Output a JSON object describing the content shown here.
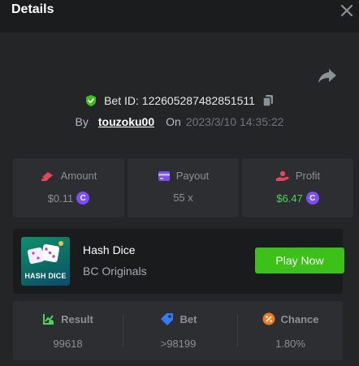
{
  "header": {
    "title": "Details"
  },
  "bet": {
    "id_text": "Bet ID: 122605287482851511",
    "by_label": "By",
    "username": "touzoku00",
    "on_label": "On",
    "datetime": "2023/3/10 14:35:22"
  },
  "stats": {
    "amount": {
      "label": "Amount",
      "value": "$0.11"
    },
    "payout": {
      "label": "Payout",
      "value": "55 x"
    },
    "profit": {
      "label": "Profit",
      "value": "$6.47"
    }
  },
  "game": {
    "thumb_text": "HASH DICE",
    "name": "Hash Dice",
    "provider": "BC Originals",
    "play_label": "Play Now"
  },
  "results": {
    "result": {
      "label": "Result",
      "value": "99618"
    },
    "bet": {
      "label": "Bet",
      "value": ">98199"
    },
    "chance": {
      "label": "Chance",
      "value": "1.80%"
    }
  },
  "colors": {
    "accent_green": "#3bc117",
    "profit_green": "#49d65a",
    "coin_purple": "#7b4dfc"
  },
  "icons": [
    "close-icon",
    "share-icon",
    "shield-check-icon",
    "copy-icon",
    "amount-icon",
    "payout-icon",
    "profit-icon",
    "coin-icon",
    "result-icon",
    "bet-icon",
    "chance-icon"
  ]
}
